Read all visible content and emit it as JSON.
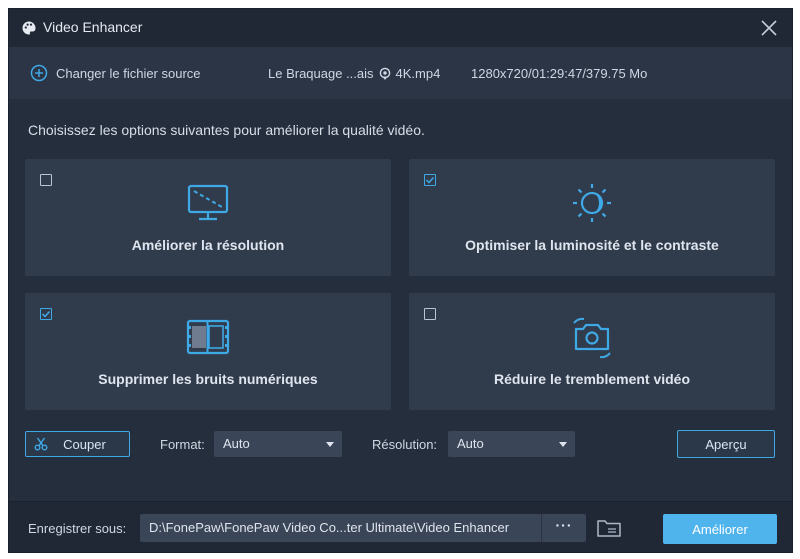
{
  "window": {
    "title": "Video Enhancer"
  },
  "source": {
    "change_label": "Changer le fichier source",
    "file_name": "Le Braquage ...ais",
    "file_suffix": "4K.mp4",
    "file_meta": "1280x720/01:29:47/379.75 Mo"
  },
  "instructions": "Choisissez les options suivantes pour améliorer la qualité vidéo.",
  "options": [
    {
      "label": "Améliorer la résolution",
      "checked": false,
      "icon": "monitor-upscale-icon"
    },
    {
      "label": "Optimiser la luminosité et le contraste",
      "checked": true,
      "icon": "brightness-icon"
    },
    {
      "label": "Supprimer les bruits numériques",
      "checked": true,
      "icon": "film-denoise-icon"
    },
    {
      "label": "Réduire le tremblement vidéo",
      "checked": false,
      "icon": "camera-stabilize-icon"
    }
  ],
  "toolbar": {
    "cut_label": "Couper",
    "format_label": "Format:",
    "format_value": "Auto",
    "resolution_label": "Résolution:",
    "resolution_value": "Auto",
    "preview_label": "Aperçu"
  },
  "footer": {
    "save_label": "Enregistrer sous:",
    "path": "D:\\FonePaw\\FonePaw Video Co...ter Ultimate\\Video Enhancer",
    "more_label": "···",
    "enhance_label": "Améliorer"
  },
  "colors": {
    "accent": "#3fa9e6",
    "primary_button": "#4fb3ec",
    "background": "#252e3d",
    "card": "#303b4c"
  }
}
